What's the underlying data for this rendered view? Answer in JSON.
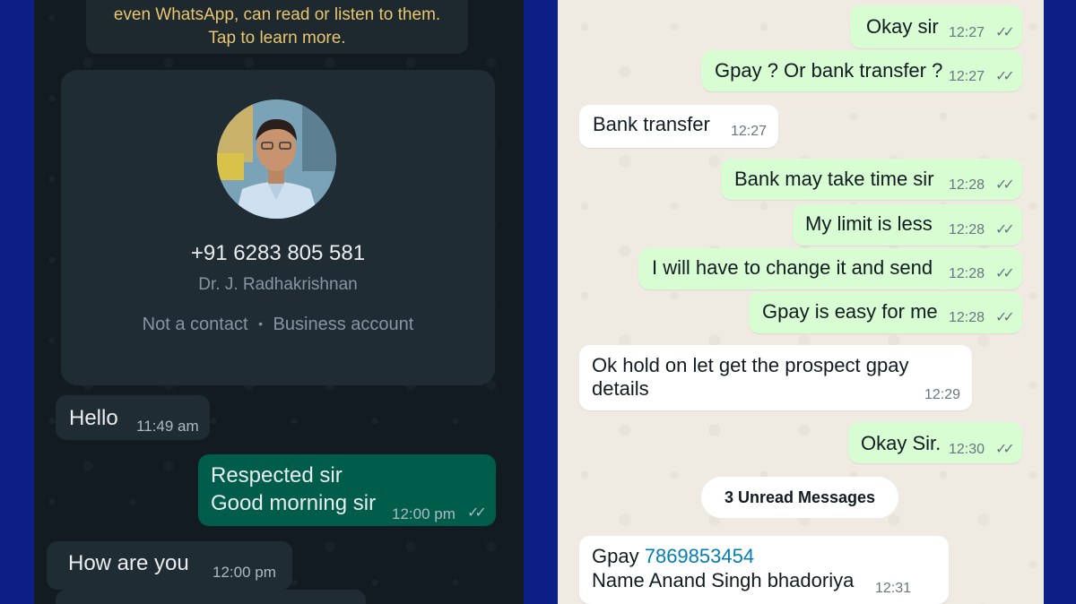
{
  "left": {
    "notice": {
      "line1": "even WhatsApp, can read or listen to them.",
      "line2": "Tap to learn more."
    },
    "contact": {
      "phone": "+91 6283 805 581",
      "name": "Dr. J. Radhakrishnan",
      "status": "Not a contact",
      "dot": "•",
      "account_type": "Business account"
    },
    "messages": [
      {
        "text": "Hello",
        "time": "11:49 am",
        "direction": "in"
      },
      {
        "line1": "Respected sir",
        "line2": "Good morning sir",
        "time": "12:00 pm",
        "ticks": "✓✓",
        "direction": "out"
      },
      {
        "text": "How are you",
        "time": "12:00 pm",
        "direction": "in"
      }
    ]
  },
  "right": {
    "messages": [
      {
        "text": "Okay sir",
        "time": "12:27",
        "ticks": "✓✓",
        "direction": "out"
      },
      {
        "text": "Gpay ? Or bank transfer ?",
        "time": "12:27",
        "ticks": "✓✓",
        "direction": "out"
      },
      {
        "text": "Bank transfer",
        "time": "12:27",
        "direction": "in"
      },
      {
        "text": "Bank may take time sir",
        "time": "12:28",
        "ticks": "✓✓",
        "direction": "out"
      },
      {
        "text": "My limit is less",
        "time": "12:28",
        "ticks": "✓✓",
        "direction": "out"
      },
      {
        "text": "I will have to change it and send",
        "time": "12:28",
        "ticks": "✓✓",
        "direction": "out"
      },
      {
        "text": "Gpay is easy for me",
        "time": "12:28",
        "ticks": "✓✓",
        "direction": "out"
      },
      {
        "line1": "Ok hold on let get the prospect gpay",
        "line2": "details",
        "time": "12:29",
        "direction": "in"
      },
      {
        "text": "Okay Sir.",
        "time": "12:30",
        "ticks": "✓✓",
        "direction": "out"
      },
      {
        "prefix": "Gpay",
        "phone_link": "7869853454",
        "line2": "Name Anand Singh bhadoriya",
        "time": "12:31",
        "direction": "in"
      }
    ],
    "unread_divider": "3 Unread Messages"
  },
  "colors": {
    "frame": "#0c1f86",
    "dark_bg": "#111b21",
    "dark_incoming": "#202c33",
    "dark_outgoing": "#005c4b",
    "light_bg": "#efeae2",
    "light_outgoing": "#d9fdd3",
    "link": "#027eb5",
    "notice_text": "#e8c66e"
  }
}
